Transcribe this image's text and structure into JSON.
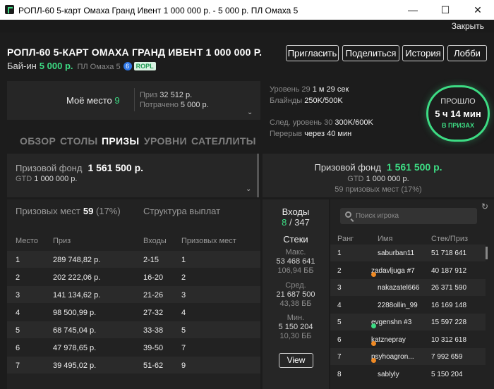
{
  "window": {
    "title": "РОПЛ-60 5-карт Омаха Гранд Ивент 1 000 000 р. - 5 000 р. ПЛ Омаха 5",
    "minimize": "—",
    "maximize": "☐",
    "close": "✕"
  },
  "menu": {
    "close_label": "Закрыть"
  },
  "header": {
    "title": "РОПЛ-60 5-КАРТ ОМАХА ГРАНД ИВЕНТ 1 000 000 Р.",
    "buyin_label": "Бай-ин",
    "buyin_value": "5 000 р.",
    "game": "ПЛ Омаха 5",
    "badge_num": "6",
    "badge_tag": "ROPL",
    "buttons": {
      "invite": "Пригласить",
      "share": "Поделиться",
      "history": "История",
      "lobby": "Лобби"
    }
  },
  "my_place": {
    "label": "Моё место",
    "value": "9",
    "prize_label": "Приз",
    "prize_value": "32 512 р.",
    "spent_label": "Потрачено",
    "spent_value": "5 000 р."
  },
  "tabs": [
    "ОБЗОР",
    "СТОЛЫ",
    "ПРИЗЫ",
    "УРОВНИ",
    "САТЕЛЛИТЫ"
  ],
  "prize_fund_left": {
    "label": "Призовой фонд",
    "value": "1 561 500 р.",
    "gtd_label": "GTD",
    "gtd_value": "1 000 000 р."
  },
  "places": {
    "label": "Призовых мест",
    "count": "59",
    "pct": "(17%)",
    "structure_label": "Структура выплат",
    "headers": {
      "place": "Место",
      "prize": "Приз",
      "entries": "Входы",
      "prize_places": "Призовых мест"
    },
    "rows": [
      {
        "place": "1",
        "prize": "289 748,82 р.",
        "entries": "2-15",
        "pp": "1"
      },
      {
        "place": "2",
        "prize": "202 222,06 р.",
        "entries": "16-20",
        "pp": "2"
      },
      {
        "place": "3",
        "prize": "141 134,62 р.",
        "entries": "21-26",
        "pp": "3"
      },
      {
        "place": "4",
        "prize": "98 500,99 р.",
        "entries": "27-32",
        "pp": "4"
      },
      {
        "place": "5",
        "prize": "68 745,04 р.",
        "entries": "33-38",
        "pp": "5"
      },
      {
        "place": "6",
        "prize": "47 978,65 р.",
        "entries": "39-50",
        "pp": "7"
      },
      {
        "place": "7",
        "prize": "39 495,02 р.",
        "entries": "51-62",
        "pp": "9"
      }
    ]
  },
  "level": {
    "level_label": "Уровень 29",
    "level_time": "1 м 29 сек",
    "blinds_label": "Блайнды",
    "blinds_value": "250K/500K",
    "next_label": "След. уровень 30",
    "next_value": "300K/600K",
    "break_label": "Перерыв",
    "break_value": "через 40 мин"
  },
  "passed": {
    "label": "ПРОШЛО",
    "time": "5 ч 14 мин",
    "status": "В ПРИЗАХ"
  },
  "prize_fund_right": {
    "label": "Призовой фонд",
    "value": "1 561 500 р.",
    "gtd_label": "GTD",
    "gtd_value": "1 000 000 р.",
    "places": "59 призовых мест (17%)"
  },
  "entries": {
    "label": "Входы",
    "current": "8",
    "total": "/ 347",
    "stacks_label": "Стеки",
    "max_label": "Макс.",
    "max_value": "53 468 641",
    "max_bb": "106,94 ББ",
    "avg_label": "Сред.",
    "avg_value": "21 687 500",
    "avg_bb": "43,38 ББ",
    "min_label": "Мин.",
    "min_value": "5 150 204",
    "min_bb": "10,30 ББ",
    "view_label": "View"
  },
  "players": {
    "search_placeholder": "Поиск игрока",
    "headers": {
      "rank": "Ранг",
      "name": "Имя",
      "stack": "Стек/Приз"
    },
    "rows": [
      {
        "rank": "1",
        "name": "saburban11",
        "stack": "51 718 641",
        "dot": ""
      },
      {
        "rank": "2",
        "name": "zadavljuga #7",
        "stack": "40 187 912",
        "dot": "#f08a24"
      },
      {
        "rank": "3",
        "name": "nakazatel666",
        "stack": "26 371 590",
        "dot": ""
      },
      {
        "rank": "4",
        "name": "2288ollin_99",
        "stack": "16 169 148",
        "dot": ""
      },
      {
        "rank": "5",
        "name": "evgenshn #3",
        "stack": "15 597 228",
        "dot": "#3ddc84"
      },
      {
        "rank": "6",
        "name": "katznepray",
        "stack": "10 312 618",
        "dot": "#f08a24"
      },
      {
        "rank": "7",
        "name": "psyhoagron...",
        "stack": "7 992 659",
        "dot": "#f08a24"
      },
      {
        "rank": "8",
        "name": "sablyly",
        "stack": "5 150 204",
        "dot": ""
      }
    ]
  }
}
